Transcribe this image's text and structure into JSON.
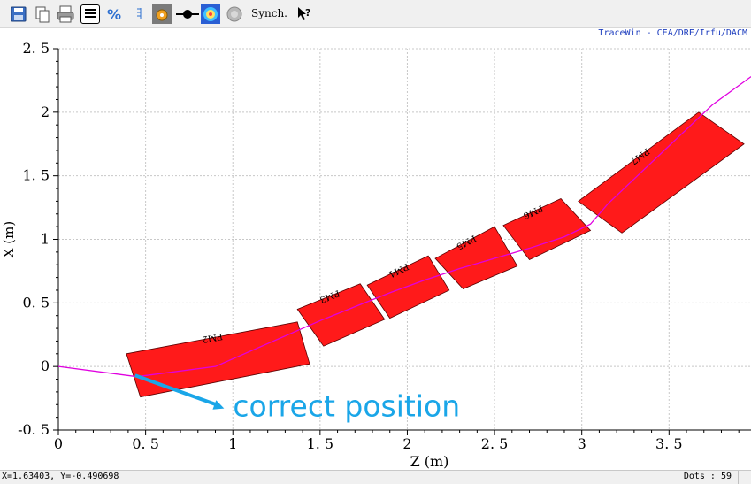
{
  "toolbar": {
    "icons": [
      "save-icon",
      "copy-icon",
      "print-icon",
      "list-icon",
      "percent-icon",
      "text-icon",
      "settings-icon",
      "element-icon",
      "beam-spot-icon",
      "circle-icon",
      "help-icon"
    ],
    "synch_label": "Synch.",
    "help_glyph": "?"
  },
  "brand": "TraceWin - CEA/DRF/Irfu/DACM",
  "chart_data": {
    "type": "scatter",
    "xlabel": "Z (m)",
    "ylabel": "X (m)",
    "xlim": [
      0,
      3.97
    ],
    "ylim": [
      -0.5,
      2.5
    ],
    "x_ticks": [
      "0",
      "0.5",
      "1",
      "1.5",
      "2",
      "2.5",
      "3",
      "3.5"
    ],
    "y_ticks": [
      "-0.5",
      "0",
      "0.5",
      "1",
      "1.5",
      "2",
      "2.5"
    ],
    "grid": true,
    "trajectory": {
      "color": "#e000e0",
      "z": [
        0,
        0.45,
        0.9,
        1.4,
        1.5,
        1.7,
        1.9,
        2.1,
        2.3,
        2.5,
        2.7,
        2.9,
        3.05,
        3.15,
        3.35,
        3.55,
        3.75,
        3.97
      ],
      "x": [
        0,
        -0.08,
        0.0,
        0.3,
        0.36,
        0.47,
        0.58,
        0.68,
        0.77,
        0.85,
        0.93,
        1.02,
        1.12,
        1.28,
        1.54,
        1.8,
        2.06,
        2.28
      ]
    },
    "elements": {
      "fill": "#ff1a1a",
      "items": [
        {
          "label": "PM2",
          "corners": [
            [
              0.39,
              0.1
            ],
            [
              1.37,
              0.35
            ],
            [
              1.44,
              0.02
            ],
            [
              0.47,
              -0.24
            ]
          ]
        },
        {
          "label": "PM3",
          "corners": [
            [
              1.37,
              0.45
            ],
            [
              1.73,
              0.65
            ],
            [
              1.87,
              0.37
            ],
            [
              1.52,
              0.16
            ]
          ]
        },
        {
          "label": "PM4",
          "corners": [
            [
              1.77,
              0.64
            ],
            [
              2.12,
              0.87
            ],
            [
              2.24,
              0.6
            ],
            [
              1.9,
              0.38
            ]
          ]
        },
        {
          "label": "PM5",
          "corners": [
            [
              2.16,
              0.85
            ],
            [
              2.5,
              1.1
            ],
            [
              2.63,
              0.79
            ],
            [
              2.32,
              0.61
            ]
          ]
        },
        {
          "label": "PM6",
          "corners": [
            [
              2.55,
              1.11
            ],
            [
              2.88,
              1.32
            ],
            [
              3.05,
              1.07
            ],
            [
              2.7,
              0.84
            ]
          ]
        },
        {
          "label": "PM7",
          "corners": [
            [
              2.98,
              1.3
            ],
            [
              3.67,
              2.0
            ],
            [
              3.93,
              1.75
            ],
            [
              3.23,
              1.05
            ]
          ]
        }
      ]
    },
    "annotation": {
      "text": "correct position",
      "color": "#1aa6e8",
      "arrow_from": [
        0.44,
        -0.07
      ],
      "arrow_to": [
        0.95,
        -0.33
      ]
    }
  },
  "status": {
    "coords": "X=1.63403, Y=-0.490698",
    "dots": "Dots : 59"
  }
}
